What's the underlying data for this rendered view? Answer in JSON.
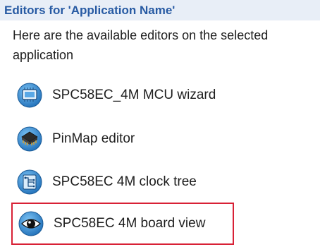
{
  "header": {
    "title": "Editors for 'Application Name'"
  },
  "description": "Here are the available editors on the selected application",
  "editors": [
    {
      "label": "SPC58EC_4M MCU wizard",
      "icon": "mcu-wizard-icon"
    },
    {
      "label": "PinMap editor",
      "icon": "chip-pinmap-icon"
    },
    {
      "label": "SPC58EC 4M clock tree",
      "icon": "clock-tree-icon"
    },
    {
      "label": "SPC58EC 4M board view",
      "icon": "eye-icon"
    }
  ],
  "colors": {
    "header_bg": "#e8eef7",
    "header_text": "#275aa3",
    "highlight_border": "#d82136",
    "icon_blue": "#3a8fd9"
  }
}
